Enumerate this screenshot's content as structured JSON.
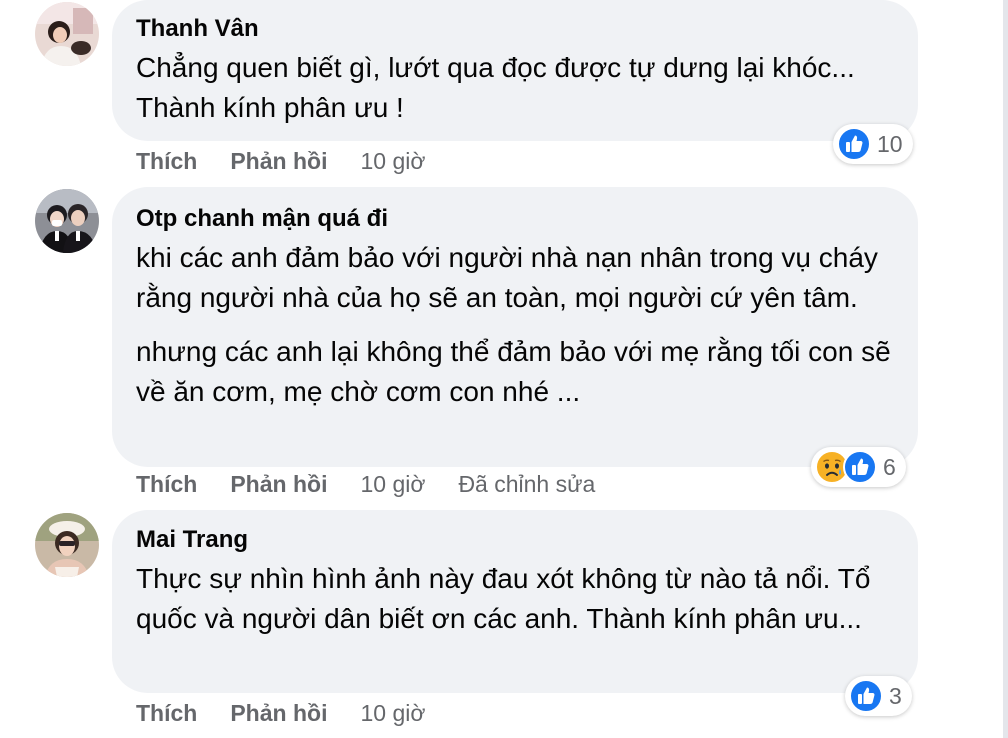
{
  "comments": [
    {
      "author": "Thanh Vân",
      "paragraphs": [
        "Chẳng quen biết gì, lướt qua đọc được tự dưng lại khóc... Thành kính phân ưu !"
      ],
      "like_label": "Thích",
      "reply_label": "Phản hồi",
      "time": "10 giờ",
      "reaction_icons": [
        "like-icon"
      ],
      "reaction_count": "10"
    },
    {
      "author": "Otp chanh mận quá đi",
      "paragraphs": [
        "khi các anh đảm bảo với người nhà nạn nhân trong vụ cháy rằng người nhà của họ sẽ an toàn, mọi người cứ yên tâm.",
        "nhưng các anh lại không thể đảm bảo với mẹ rằng tối con sẽ về ăn cơm, mẹ chờ cơm con nhé ..."
      ],
      "like_label": "Thích",
      "reply_label": "Phản hồi",
      "time": "10 giờ",
      "edited": "Đã chỉnh sửa",
      "reaction_icons": [
        "sad-icon",
        "like-icon"
      ],
      "reaction_count": "6"
    },
    {
      "author": "Mai Trang",
      "paragraphs": [
        "Thực sự nhìn hình ảnh này đau xót không từ nào tả nổi. Tổ quốc và người dân biết ơn các anh. Thành kính phân ưu..."
      ],
      "like_label": "Thích",
      "reply_label": "Phản hồi",
      "time": "10 giờ",
      "reaction_icons": [
        "like-icon"
      ],
      "reaction_count": "3"
    }
  ],
  "colors": {
    "bubble": "#f0f2f5",
    "secondary_text": "#65676b",
    "like_blue": "#1877f2",
    "sad_yellow": "#f7b125"
  }
}
